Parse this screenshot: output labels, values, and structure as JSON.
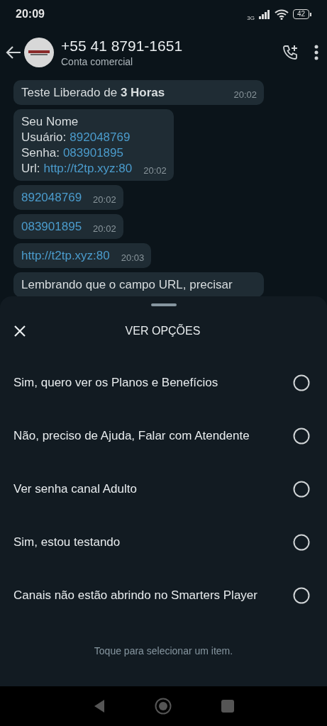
{
  "status_bar": {
    "time": "20:09",
    "network": "3G",
    "battery": "42"
  },
  "header": {
    "title": "+55 41 8791-1651",
    "subtitle": "Conta comercial"
  },
  "messages": [
    {
      "lines": [
        {
          "text": "Teste Liberado de **3 Horas**"
        }
      ],
      "time": "20:02"
    },
    {
      "lines": [
        {
          "text": "Seu Nome"
        },
        {
          "text": "Usuário:",
          "link": "892048769"
        },
        {
          "text": "Senha:",
          "link": "083901895"
        },
        {
          "text": "Url:",
          "link": "http://t2tp.xyz:80"
        }
      ],
      "time": "20:02"
    },
    {
      "lines": [
        {
          "link": "892048769"
        }
      ],
      "time": "20:02"
    },
    {
      "lines": [
        {
          "link": "083901895"
        }
      ],
      "time": "20:02"
    },
    {
      "lines": [
        {
          "link": "http://t2tp.xyz:80"
        }
      ],
      "time": "20:03"
    },
    {
      "lines": [
        {
          "text": "Lembrando que o campo URL, precisar"
        }
      ]
    }
  ],
  "sheet": {
    "title": "VER OPÇÕES",
    "options": [
      {
        "label": "Sim, quero ver os Planos e Benefícios",
        "selected": false
      },
      {
        "label": "Não, preciso de Ajuda, Falar com Atendente",
        "selected": false
      },
      {
        "label": "Ver senha canal Adulto",
        "selected": false
      },
      {
        "label": "Sim, estou testando",
        "selected": false
      },
      {
        "label": "Canais não estão abrindo no Smarters Player",
        "selected": false
      }
    ],
    "hint": "Toque para selecionar um item."
  }
}
